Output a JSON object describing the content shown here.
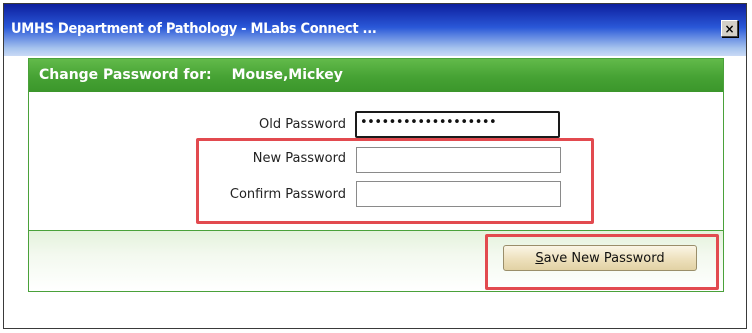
{
  "window": {
    "title": "UMHS Department of Pathology - MLabs Connect ...",
    "close_glyph": "×",
    "close_icon": "close-icon"
  },
  "panel": {
    "header_prefix": "Change Password for:",
    "user_name": "Mouse,Mickey"
  },
  "form": {
    "old_password_label": "Old Password",
    "old_password_masked": "•••••••••••••••••••",
    "new_password_label": "New Password",
    "new_password_value": "",
    "confirm_password_label": "Confirm Password",
    "confirm_password_value": ""
  },
  "actions": {
    "save_label_accel": "S",
    "save_label_rest": "ave New Password"
  },
  "colors": {
    "title_blue": "#0d1f9e",
    "panel_green": "#46a234",
    "highlight_red": "#e24a4f"
  }
}
